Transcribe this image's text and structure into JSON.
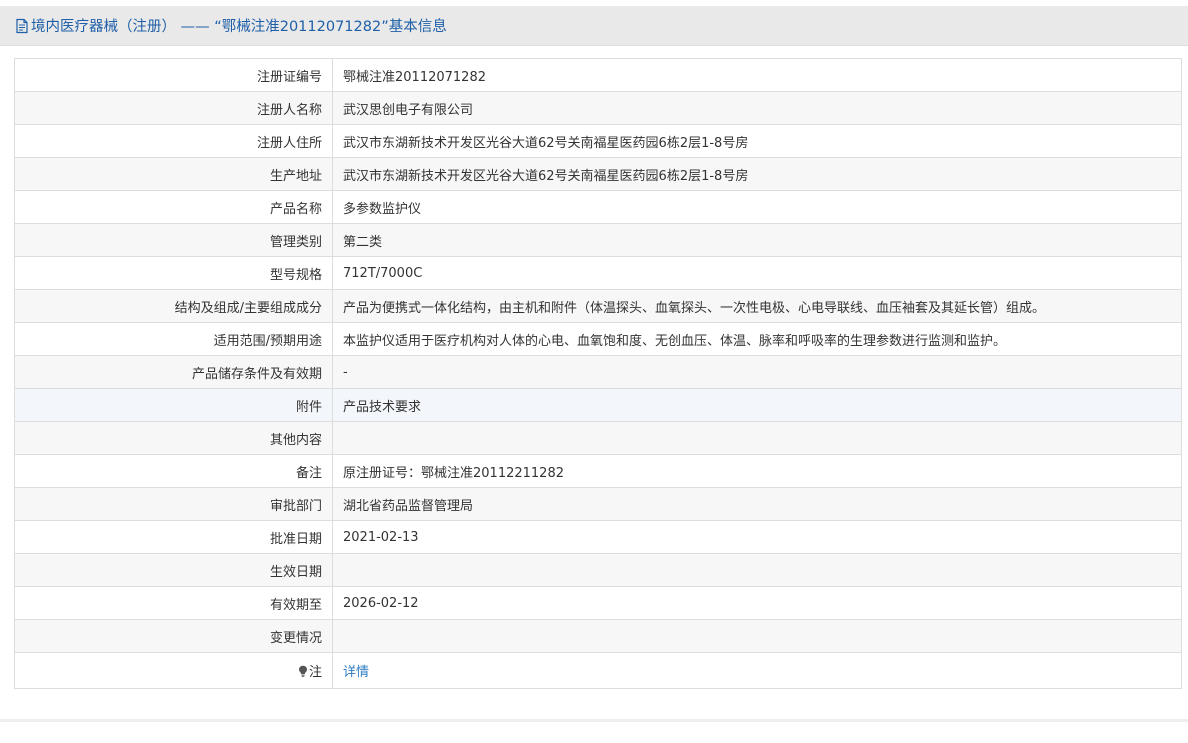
{
  "header": {
    "icon": "document-icon",
    "title": "境内医疗器械（注册） —— “鄂械注准20112071282”基本信息"
  },
  "colors": {
    "title": "#1f5fa8",
    "link": "#2d7cc4",
    "border": "#dddddd",
    "header_bg": "#e9e9e9"
  },
  "rows": [
    {
      "label": "注册证编号",
      "value": "鄂械注准20112071282"
    },
    {
      "label": "注册人名称",
      "value": "武汉思创电子有限公司"
    },
    {
      "label": "注册人住所",
      "value": "武汉市东湖新技术开发区光谷大道62号关南福星医药园6栋2层1-8号房"
    },
    {
      "label": "生产地址",
      "value": "武汉市东湖新技术开发区光谷大道62号关南福星医药园6栋2层1-8号房"
    },
    {
      "label": "产品名称",
      "value": "多参数监护仪"
    },
    {
      "label": "管理类别",
      "value": "第二类"
    },
    {
      "label": "型号规格",
      "value": "712T/7000C"
    },
    {
      "label": "结构及组成/主要组成成分",
      "value": "产品为便携式一体化结构，由主机和附件（体温探头、血氧探头、一次性电极、心电导联线、血压袖套及其延长管）组成。"
    },
    {
      "label": "适用范围/预期用途",
      "value": "本监护仪适用于医疗机构对人体的心电、血氧饱和度、无创血压、体温、脉率和呼吸率的生理参数进行监测和监护。"
    },
    {
      "label": "产品储存条件及有效期",
      "value": "-"
    },
    {
      "label": "附件",
      "value": "产品技术要求"
    },
    {
      "label": "其他内容",
      "value": ""
    },
    {
      "label": "备注",
      "value": "原注册证号：鄂械注准20112211282"
    },
    {
      "label": "审批部门",
      "value": "湖北省药品监督管理局"
    },
    {
      "label": "批准日期",
      "value": "2021-02-13"
    },
    {
      "label": "生效日期",
      "value": ""
    },
    {
      "label": "有效期至",
      "value": "2026-02-12"
    },
    {
      "label": "变更情况",
      "value": ""
    }
  ],
  "note_row": {
    "icon": "lightbulb-icon",
    "label": "注",
    "link_text": "详情"
  }
}
